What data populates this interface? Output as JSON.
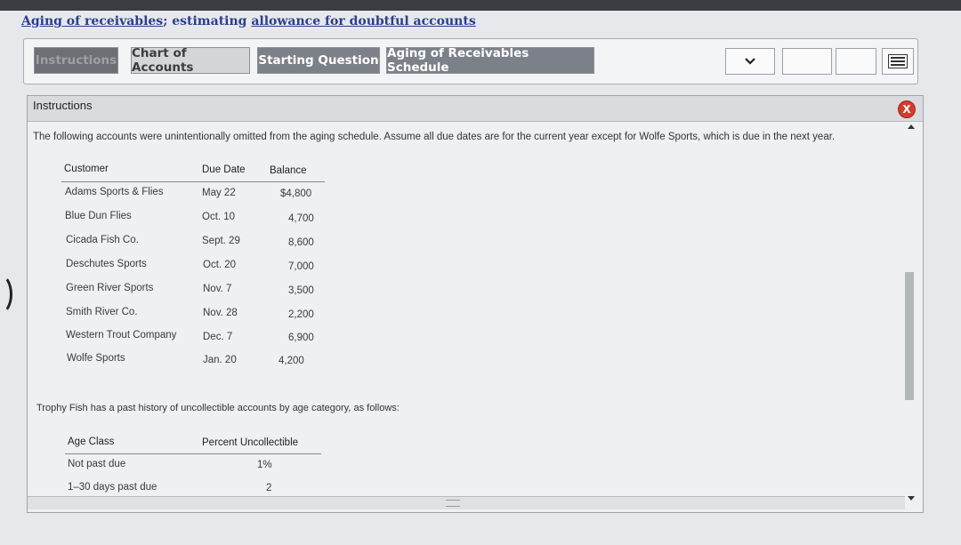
{
  "page": {
    "title_part1": "Aging of receivables",
    "title_part2": "; estimating ",
    "title_part3": "allowance for doubtful accounts"
  },
  "tabs": {
    "instructions": "Instructions",
    "chart_of_accounts": "Chart of Accounts",
    "starting_question": "Starting Question",
    "aging_schedule": "Aging of Receivables Schedule"
  },
  "nav": {
    "dropdown_icon": "chevron-down-icon",
    "menu_icon": "menu-icon"
  },
  "panel": {
    "title": "Instructions",
    "close_label": "X",
    "intro": "The following accounts were unintentionally omitted from the aging schedule. Assume all due dates are for the current year except for Wolfe Sports, which is due in the next year.",
    "customer_table": {
      "headers": [
        "Customer",
        "Due Date",
        "Balance"
      ],
      "rows": [
        [
          "Adams Sports & Flies",
          "May 22",
          "$4,800"
        ],
        [
          "Blue Dun Flies",
          "Oct. 10",
          "4,700"
        ],
        [
          "Cicada Fish Co.",
          "Sept. 29",
          "8,600"
        ],
        [
          "Deschutes Sports",
          "Oct. 20",
          "7,000"
        ],
        [
          "Green River Sports",
          "Nov. 7",
          "3,500"
        ],
        [
          "Smith River Co.",
          "Nov. 28",
          "2,200"
        ],
        [
          "Western Trout Company",
          "Dec. 7",
          "6,900"
        ],
        [
          "Wolfe Sports",
          "Jan. 20",
          "4,200"
        ]
      ]
    },
    "history_intro": "Trophy Fish has a past history of uncollectible accounts by age category, as follows:",
    "age_table": {
      "headers": [
        "Age Class",
        "Percent Uncollectible"
      ],
      "rows": [
        [
          "Not past due",
          "1%"
        ],
        [
          "1–30 days past due",
          "2"
        ]
      ]
    }
  },
  "colors": {
    "title_link": "#2b3f8c",
    "close_button": "#d43b2c",
    "active_tab": "#6c6f73"
  }
}
